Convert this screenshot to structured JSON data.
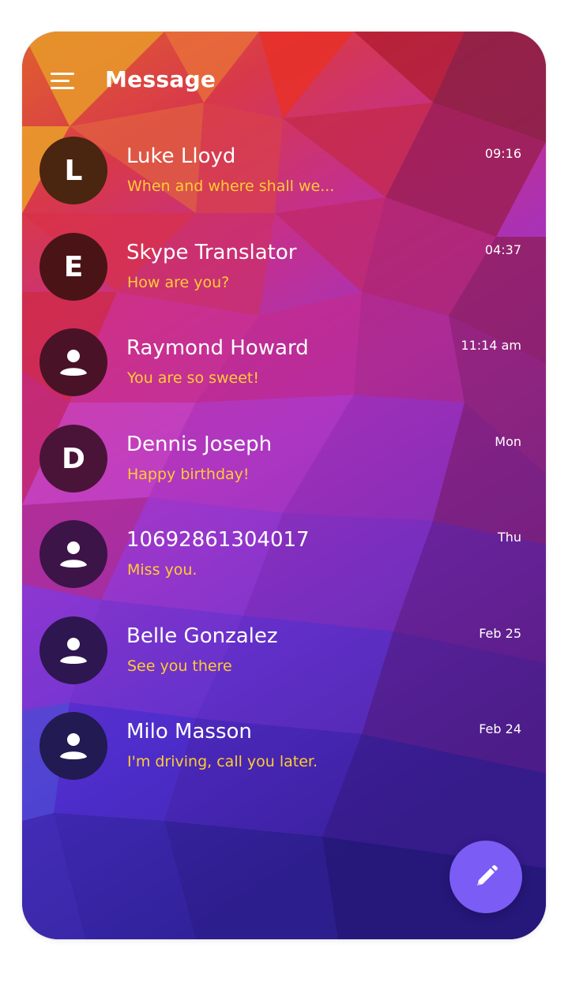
{
  "header": {
    "title": "Message",
    "menu_icon": "hamburger-menu-icon"
  },
  "colors": {
    "name_text": "#ffffff",
    "preview_text": "#ffcc33",
    "fab_bg": "#7b5cf5"
  },
  "conversations": [
    {
      "name": "Luke Lloyd",
      "preview": "When and where shall we...",
      "time": "09:16",
      "avatar_letter": "L",
      "avatar_color": "#4a2510"
    },
    {
      "name": "Skype Translator",
      "preview": "How are you?",
      "time": "04:37",
      "avatar_letter": "E",
      "avatar_color": "#4a1416"
    },
    {
      "name": "Raymond Howard",
      "preview": "You are so sweet!",
      "time": "11:14 am",
      "avatar_letter": "",
      "avatar_color": "#4a1226"
    },
    {
      "name": "Dennis Joseph",
      "preview": "Happy birthday!",
      "time": "Mon",
      "avatar_letter": "D",
      "avatar_color": "#4a1438"
    },
    {
      "name": "10692861304017",
      "preview": "Miss you.",
      "time": "Thu",
      "avatar_letter": "",
      "avatar_color": "#3c1448"
    },
    {
      "name": "Belle Gonzalez",
      "preview": "See you there",
      "time": "Feb 25",
      "avatar_letter": "",
      "avatar_color": "#2e1650"
    },
    {
      "name": "Milo Masson",
      "preview": "I'm driving, call you later.",
      "time": "Feb 24",
      "avatar_letter": "",
      "avatar_color": "#221a52"
    }
  ],
  "fab": {
    "icon": "pencil-icon"
  }
}
